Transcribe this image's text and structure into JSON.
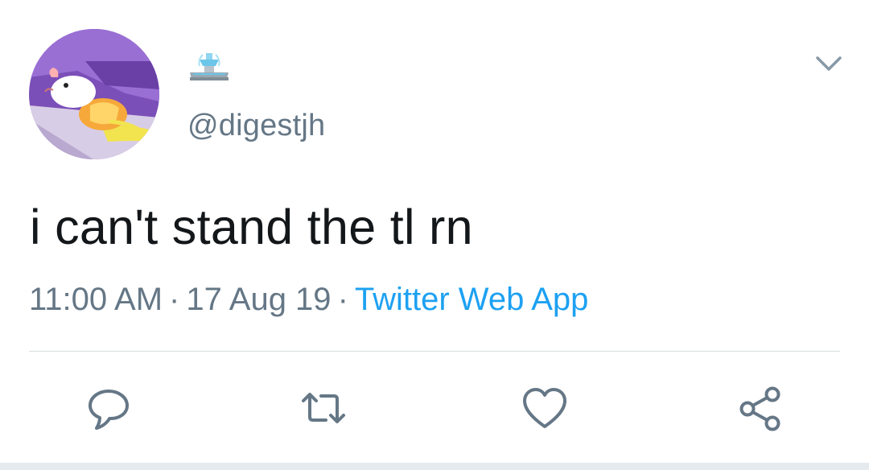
{
  "tweet": {
    "display_name_icon": "fountain-emoji",
    "handle": "@digestjh",
    "text": "i can't stand the tl rn",
    "time": "11:00 AM",
    "separator": "·",
    "date": "17 Aug 19",
    "source": "Twitter Web App"
  },
  "actions": {
    "reply": "reply-icon",
    "retweet": "retweet-icon",
    "like": "heart-icon",
    "share": "share-icon"
  },
  "colors": {
    "text": "#14171a",
    "secondary": "#657786",
    "link": "#1da1f2",
    "divider": "#d9dfe3"
  }
}
